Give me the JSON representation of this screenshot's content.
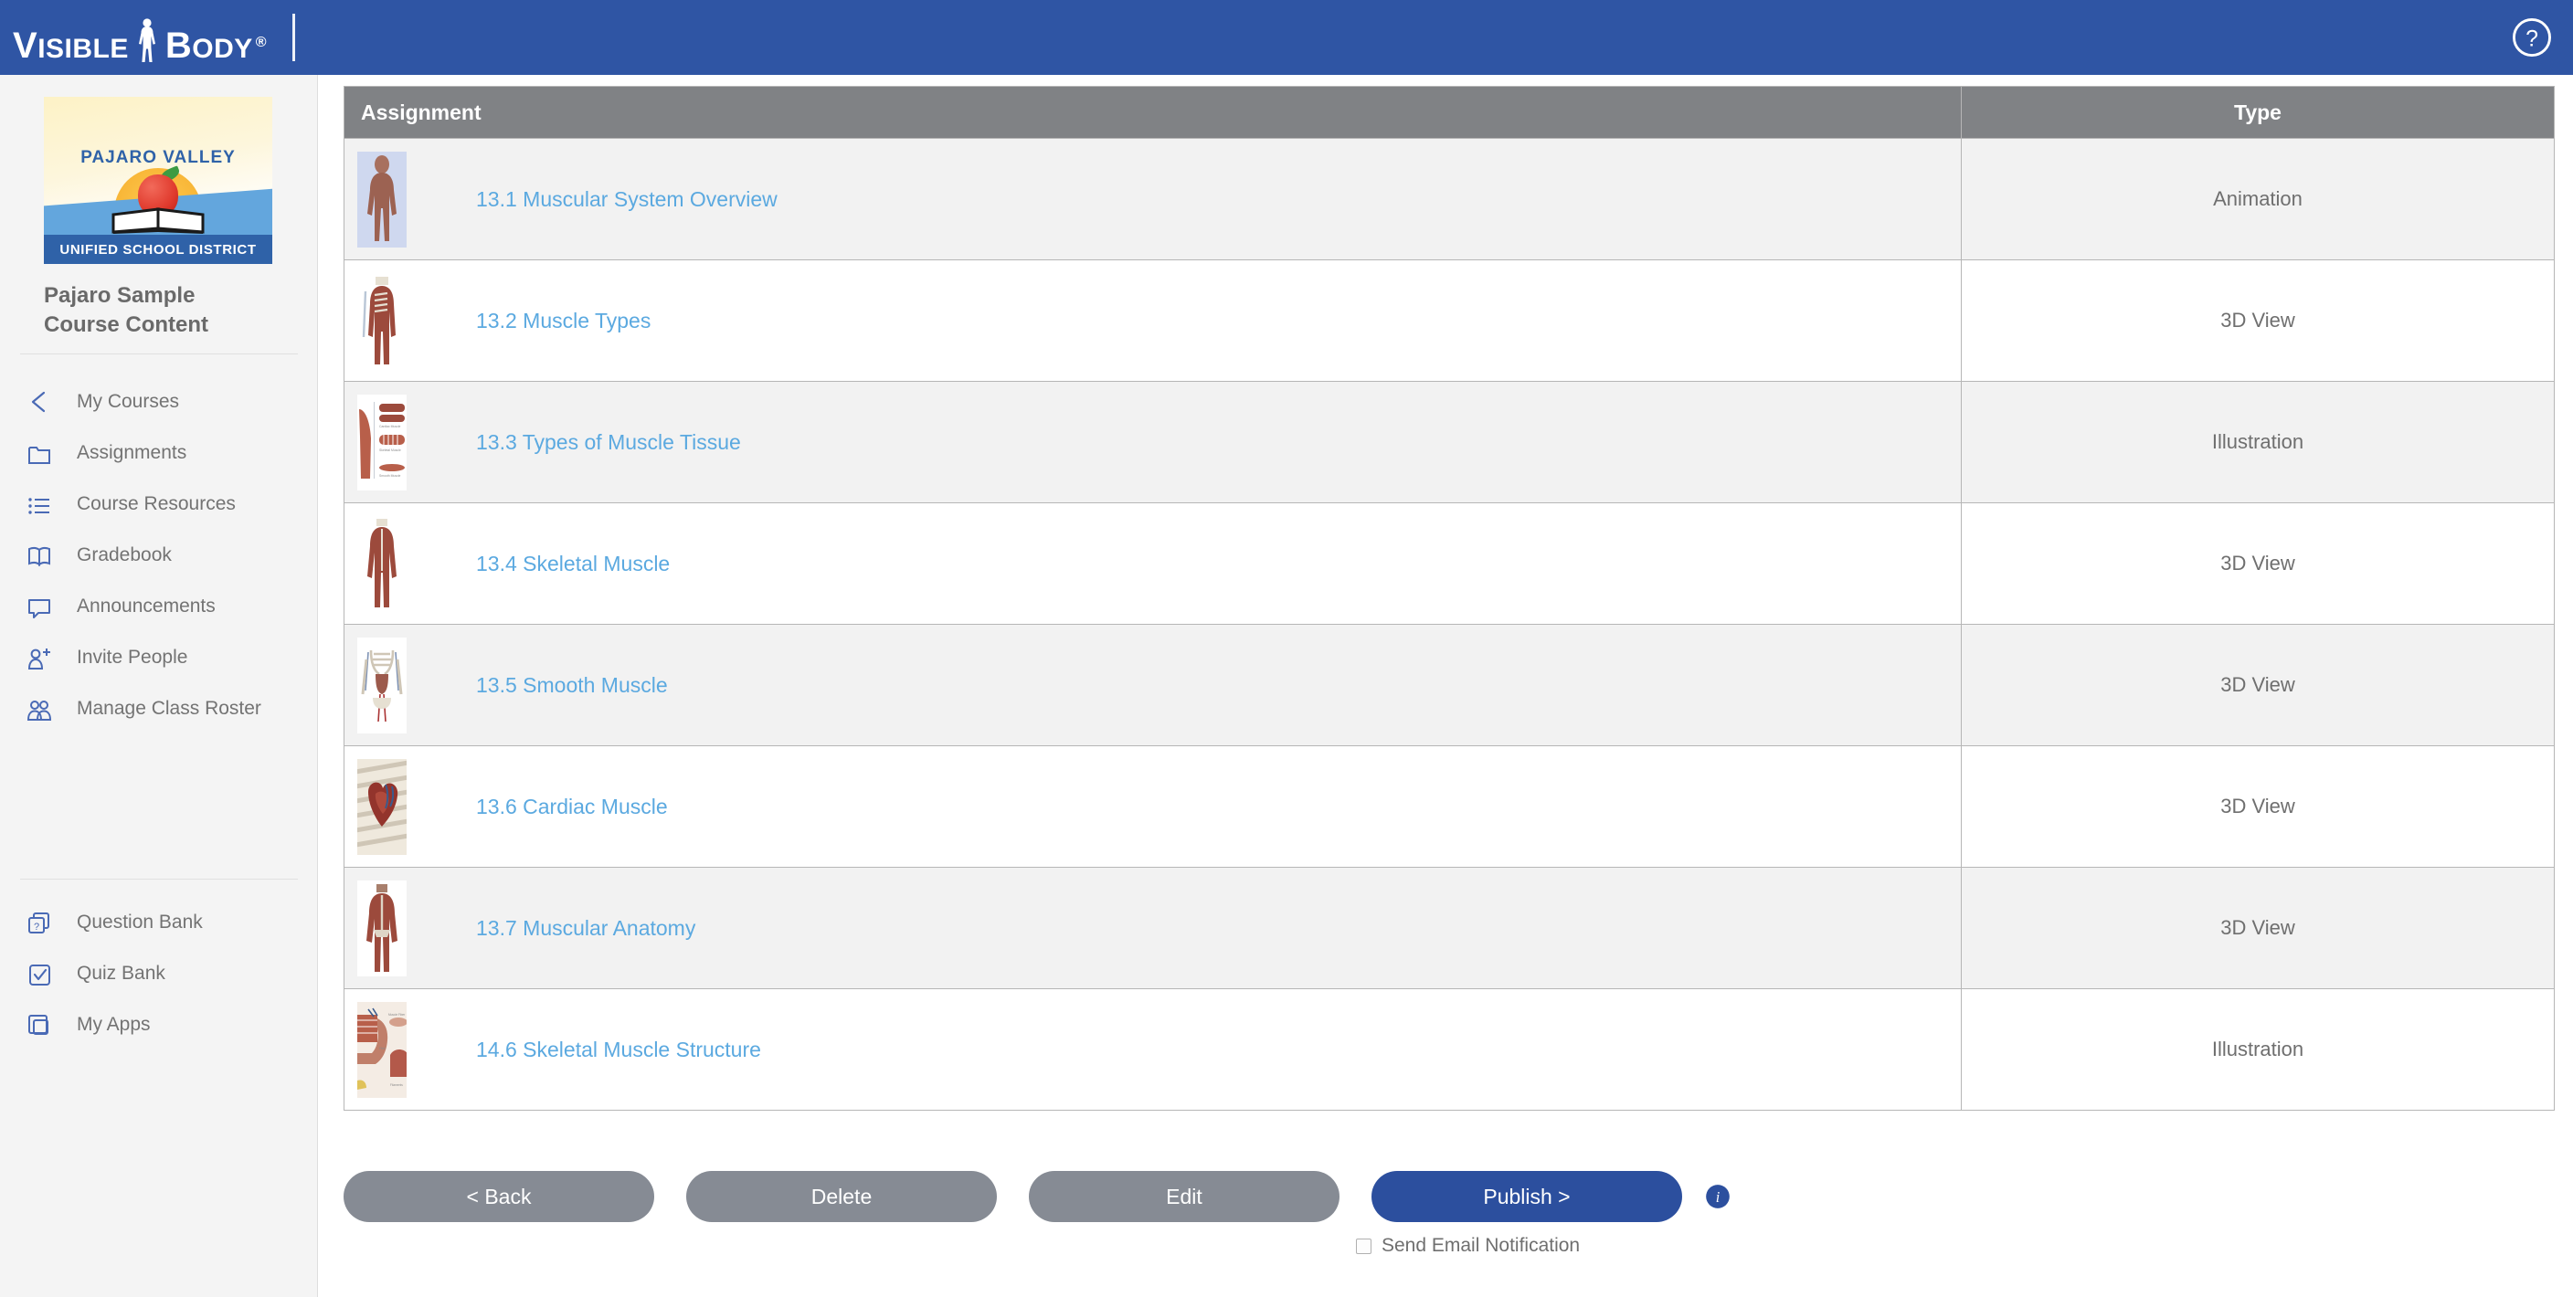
{
  "header": {
    "brand_primary": "VISIBLE",
    "brand_secondary": "BODY",
    "brand_registered": "®",
    "help_icon": "help-circle-icon",
    "bar_color": "#2f55a4"
  },
  "sidebar": {
    "school_logo": {
      "arc_text": "PAJARO VALLEY",
      "banner_text": "UNIFIED SCHOOL DISTRICT"
    },
    "course_title": "Pajaro Sample Course Content",
    "items": [
      {
        "label": "My Courses",
        "icon": "chevron-left-icon"
      },
      {
        "label": "Assignments",
        "icon": "folder-icon"
      },
      {
        "label": "Course Resources",
        "icon": "list-icon"
      },
      {
        "label": "Gradebook",
        "icon": "open-book-icon"
      },
      {
        "label": "Announcements",
        "icon": "speech-bubble-icon"
      },
      {
        "label": "Invite People",
        "icon": "person-add-icon"
      },
      {
        "label": "Manage Class Roster",
        "icon": "people-icon"
      }
    ],
    "items_secondary": [
      {
        "label": "Question Bank",
        "icon": "question-cards-icon"
      },
      {
        "label": "Quiz Bank",
        "icon": "checkbox-check-icon"
      },
      {
        "label": "My Apps",
        "icon": "apps-squares-icon"
      }
    ],
    "icon_color": "#4a6ab5",
    "label_color": "#737373"
  },
  "table": {
    "columns": [
      "Assignment",
      "Type"
    ],
    "header_bg": "#808285",
    "link_color": "#5ba9e0",
    "rows": [
      {
        "title": "13.1 Muscular System Overview",
        "type": "Animation",
        "thumb": "muscular-figure-blue-thumbnail"
      },
      {
        "title": "13.2 Muscle Types",
        "type": "3D View",
        "thumb": "torso-skeleton-muscle-thumbnail"
      },
      {
        "title": "13.3 Types of Muscle Tissue",
        "type": "Illustration",
        "thumb": "muscle-tissue-chart-thumbnail"
      },
      {
        "title": "13.4 Skeletal Muscle",
        "type": "3D View",
        "thumb": "skeletal-muscle-figure-thumbnail"
      },
      {
        "title": "13.5 Smooth Muscle",
        "type": "3D View",
        "thumb": "skeleton-organs-thumbnail"
      },
      {
        "title": "13.6 Cardiac Muscle",
        "type": "3D View",
        "thumb": "heart-ribcage-thumbnail"
      },
      {
        "title": "13.7 Muscular Anatomy",
        "type": "3D View",
        "thumb": "full-muscular-figure-thumbnail"
      },
      {
        "title": "14.6 Skeletal Muscle Structure",
        "type": "Illustration",
        "thumb": "muscle-fiber-diagram-thumbnail"
      }
    ]
  },
  "footer": {
    "back_label": "< Back",
    "delete_label": "Delete",
    "edit_label": "Edit",
    "publish_label": "Publish >",
    "info_icon": "info-circle-icon",
    "email_label": "Send Email Notification",
    "email_checked": false,
    "gray_button_color": "#868b94",
    "publish_button_color": "#2c4f9e"
  }
}
